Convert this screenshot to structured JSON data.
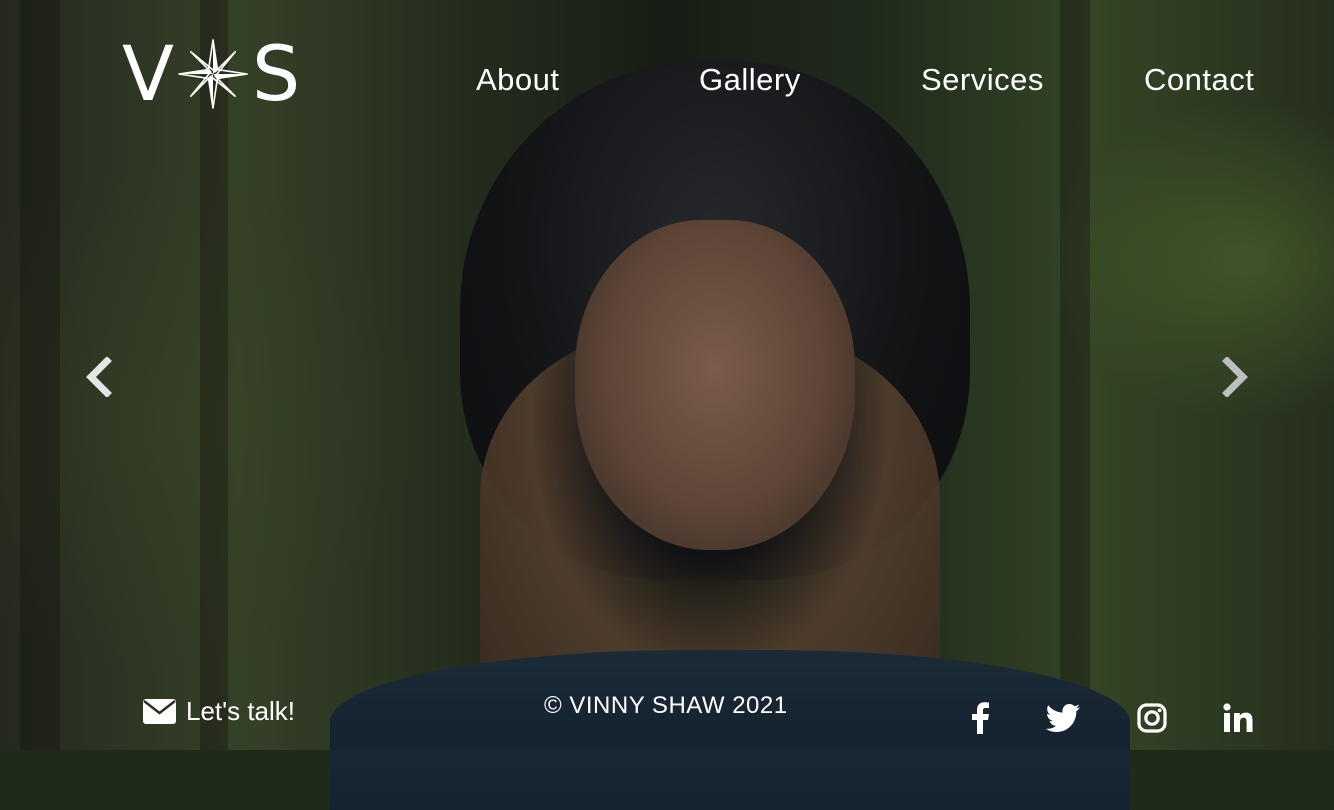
{
  "logo": {
    "left_letter": "V",
    "right_letter": "S",
    "mark_icon": "compass-star-icon"
  },
  "nav": {
    "items": [
      {
        "label": "About"
      },
      {
        "label": "Gallery"
      },
      {
        "label": "Services"
      },
      {
        "label": "Contact"
      }
    ]
  },
  "carousel": {
    "prev_icon": "chevron-left-icon",
    "next_icon": "chevron-right-icon"
  },
  "footer": {
    "contact_label": "Let's talk!",
    "contact_icon": "envelope-icon",
    "copyright": "© VINNY SHAW 2021",
    "social": [
      "facebook-icon",
      "twitter-icon",
      "instagram-icon",
      "linkedin-icon"
    ]
  }
}
